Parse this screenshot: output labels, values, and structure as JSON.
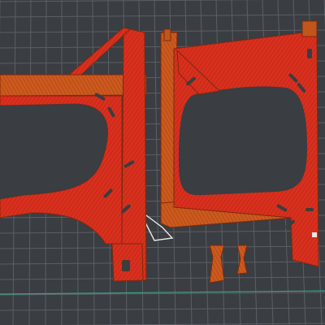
{
  "viewport": {
    "background": "#3a3d41",
    "grid_color": "#5a6068",
    "plate_edge_color": "#3fa08a",
    "outline_color": "#e8e8e8"
  },
  "model": {
    "infill_color": "#d9301f",
    "wall_color": "#c0561b",
    "edge_color": "#7a2a12",
    "parts": [
      {
        "name": "left-frame-part"
      },
      {
        "name": "right-frame-part"
      },
      {
        "name": "small-clip-part-1"
      },
      {
        "name": "small-clip-part-2"
      }
    ]
  }
}
